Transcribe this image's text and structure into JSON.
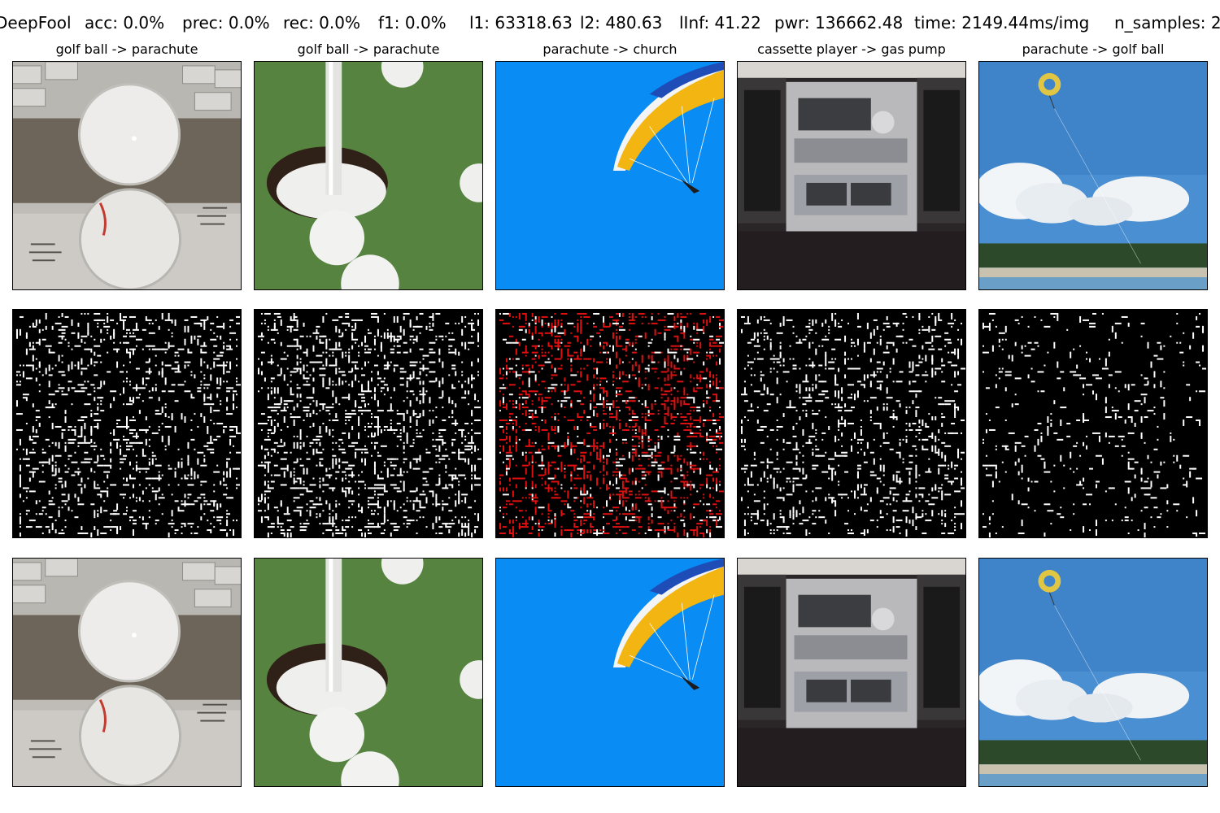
{
  "header": {
    "method": "DeepFool",
    "acc": "acc: 0.0%",
    "prec": "prec: 0.0%",
    "rec": "rec: 0.0%",
    "f1": "f1: 0.0%",
    "l1": "l1: 63318.63",
    "l2": "l2: 480.63",
    "linf": "lInf: 41.22",
    "pwr": "pwr: 136662.48",
    "time": "time: 2149.44ms/img",
    "n_samples": "n_samples: 2"
  },
  "columns": [
    {
      "title": "golf ball -> parachute"
    },
    {
      "title": "golf ball -> parachute"
    },
    {
      "title": "parachute -> church"
    },
    {
      "title": "cassette player -> gas pump"
    },
    {
      "title": "parachute -> golf ball"
    }
  ],
  "rows": [
    "original",
    "perturbation",
    "adversarial"
  ],
  "colors": {
    "background": "#ffffff",
    "perturbation_bg": "#000000",
    "noise_white": "#ffffff",
    "noise_red": "#e01010",
    "sky_blue": "#0a8cf5"
  }
}
